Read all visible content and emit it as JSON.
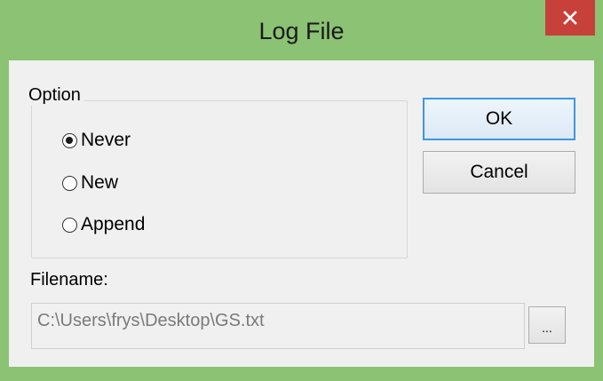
{
  "window": {
    "title": "Log File",
    "accent_color": "#8bc274",
    "close_color": "#c8403a",
    "close_icon": "close-icon"
  },
  "option_group": {
    "legend": "Option",
    "options": [
      {
        "label": "Never",
        "checked": true
      },
      {
        "label": "New",
        "checked": false
      },
      {
        "label": "Append",
        "checked": false
      }
    ]
  },
  "buttons": {
    "ok_label": "OK",
    "cancel_label": "Cancel",
    "browse_label": "..."
  },
  "filename": {
    "label": "Filename:",
    "value": "C:\\Users\\frys\\Desktop\\GS.txt"
  }
}
